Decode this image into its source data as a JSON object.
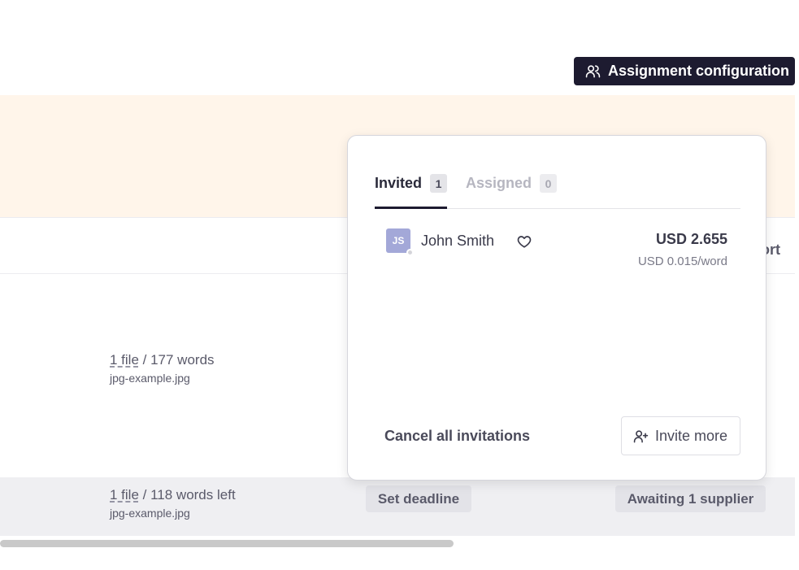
{
  "toolbar": {
    "assignment_config_label": "Assignment configuration"
  },
  "table": {
    "header_cut_text": "ort",
    "rows": [
      {
        "file_link": "1 file",
        "words": " / 177 words",
        "filename": "jpg-example.jpg"
      },
      {
        "file_link": "1 file",
        "words": " / 118 words left",
        "filename": "jpg-example.jpg",
        "deadline_label": "Set deadline",
        "status_label": "Awaiting 1 supplier"
      }
    ]
  },
  "popover": {
    "tabs": [
      {
        "label": "Invited",
        "count": "1",
        "active": true
      },
      {
        "label": "Assigned",
        "count": "0",
        "active": false
      }
    ],
    "suppliers": [
      {
        "initials": "JS",
        "name": "John Smith",
        "price": "USD 2.655",
        "rate": "USD 0.015/word"
      }
    ],
    "cancel_label": "Cancel all invitations",
    "invite_more_label": "Invite more"
  },
  "icons": {
    "assignment": "users-icon",
    "favorite": "heart-icon",
    "invite": "user-plus-icon"
  },
  "colors": {
    "primary_dark": "#1d1b30",
    "banner": "#fff5ea",
    "avatar": "#a3a8d8"
  }
}
